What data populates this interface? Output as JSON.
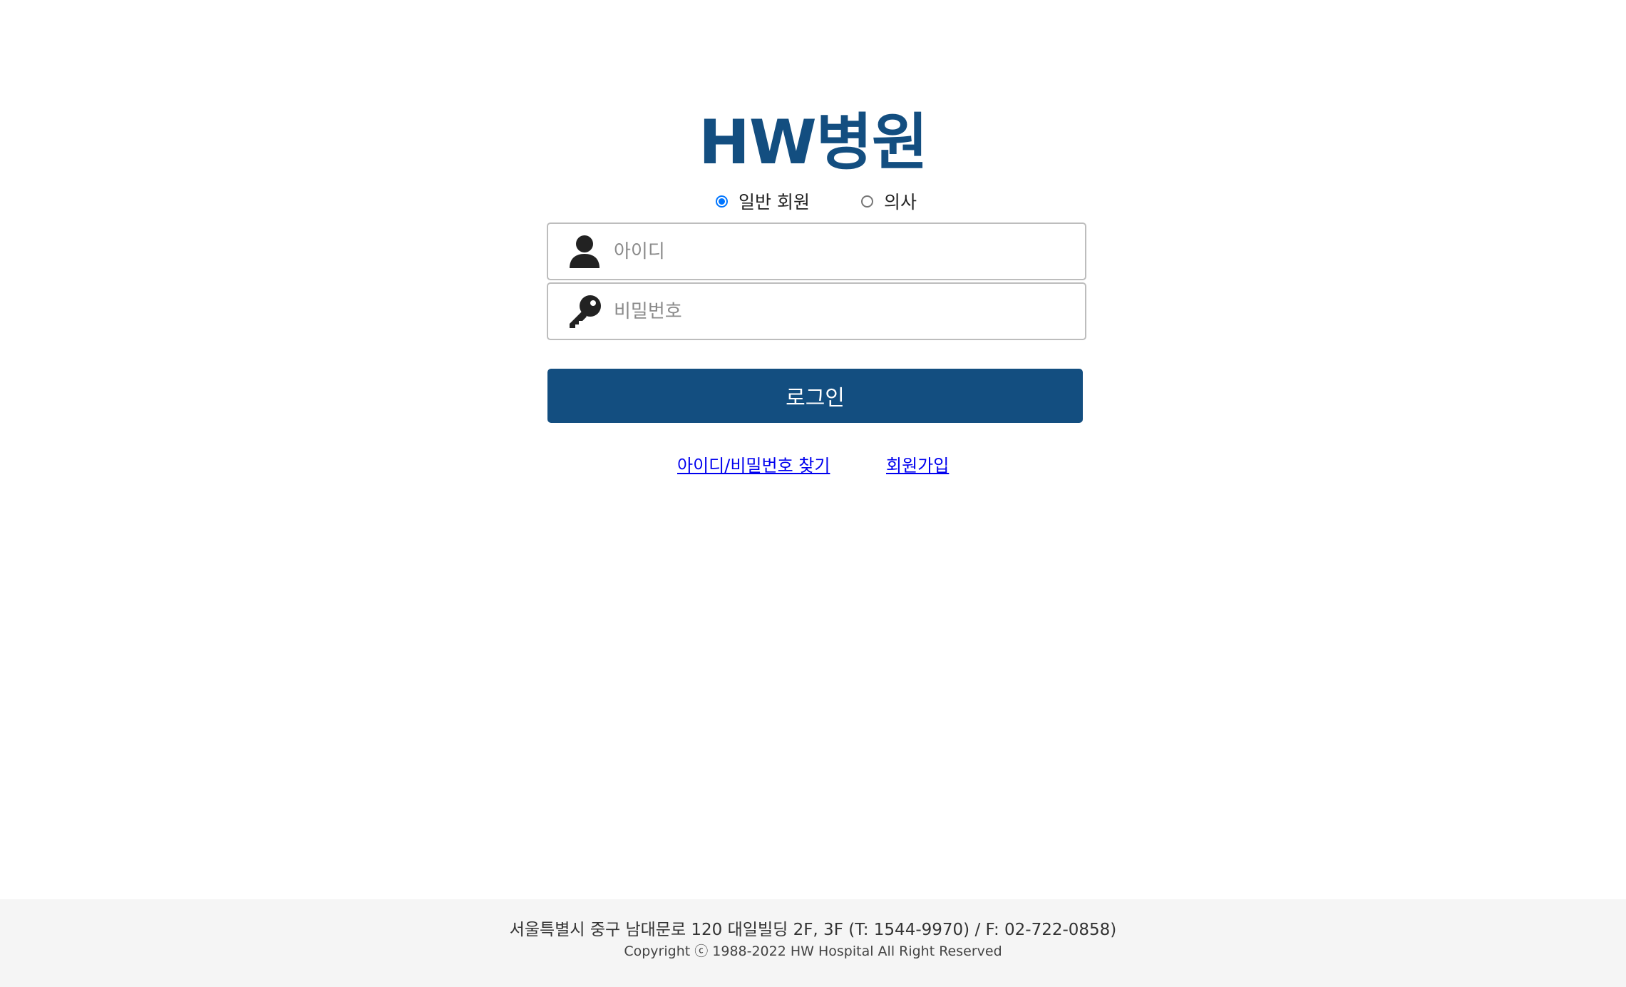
{
  "brand": {
    "logo_text": "HW병원",
    "color": "#134e80"
  },
  "member_type": {
    "options": [
      {
        "label": "일반 회원",
        "checked": true
      },
      {
        "label": "의사",
        "checked": false
      }
    ]
  },
  "login_form": {
    "id_placeholder": "아이디",
    "id_value": "",
    "id_icon": "user-icon",
    "password_placeholder": "비밀번호",
    "password_value": "",
    "password_icon": "key-icon",
    "submit_label": "로그인"
  },
  "links": {
    "find_account": "아이디/비밀번호 찾기",
    "sign_up": "회원가입",
    "color": "#0000ee"
  },
  "footer": {
    "address": "서울특별시 중구 남대문로 120 대일빌딩 2F, 3F (T: 1544-9970) / F: 02-722-0858)",
    "copyright": "Copyright ⓒ 1988-2022 HW Hospital All Right Reserved"
  }
}
